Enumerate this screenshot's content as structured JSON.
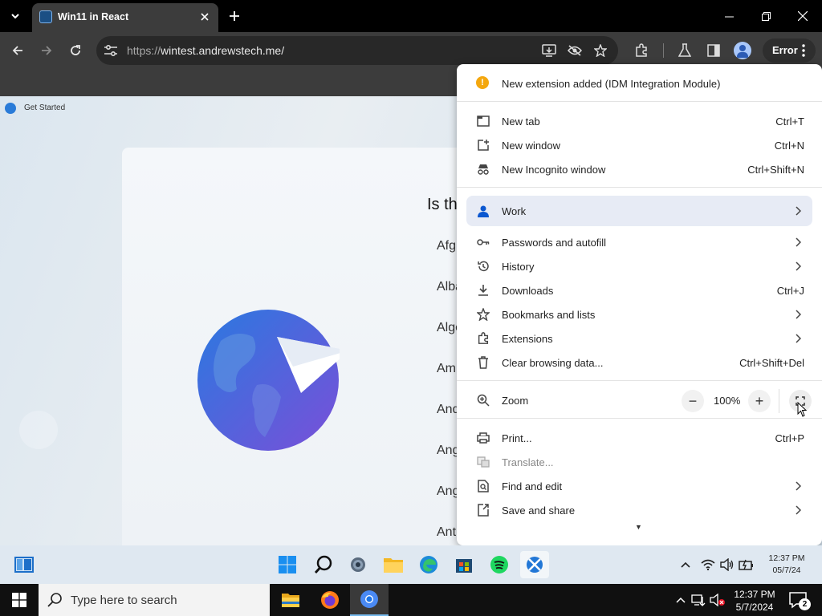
{
  "browser": {
    "tab": {
      "title": "Win11 in React"
    },
    "omnibox": {
      "protocol": "https://",
      "host": "wintest.andrewstech.me/"
    },
    "profile_status": "Error"
  },
  "page": {
    "get_started_label": "Get Started",
    "question": "Is th",
    "countries": [
      "Afg",
      "Alba",
      "Alge",
      "Am",
      "And",
      "Ang",
      "Ang",
      "Ant"
    ]
  },
  "menu": {
    "notice": "New extension added (IDM Integration Module)",
    "items": [
      {
        "label": "New tab",
        "shortcut": "Ctrl+T"
      },
      {
        "label": "New window",
        "shortcut": "Ctrl+N"
      },
      {
        "label": "New Incognito window",
        "shortcut": "Ctrl+Shift+N"
      },
      {
        "label": "Work"
      },
      {
        "label": "Passwords and autofill"
      },
      {
        "label": "History"
      },
      {
        "label": "Downloads",
        "shortcut": "Ctrl+J"
      },
      {
        "label": "Bookmarks and lists"
      },
      {
        "label": "Extensions"
      },
      {
        "label": "Clear browsing data...",
        "shortcut": "Ctrl+Shift+Del"
      },
      {
        "label": "Zoom"
      },
      {
        "label": "Print...",
        "shortcut": "Ctrl+P"
      },
      {
        "label": "Translate..."
      },
      {
        "label": "Find and edit"
      },
      {
        "label": "Save and share"
      }
    ],
    "zoom": {
      "value": "100%",
      "minus": "−",
      "plus": "+"
    }
  },
  "win11_taskbar": {
    "clock_time": "12:37 PM",
    "clock_date": "05/7/24"
  },
  "taskbar": {
    "search_placeholder": "Type here to search",
    "clock_time": "12:37 PM",
    "clock_date": "5/7/2024",
    "notification_count": "2"
  },
  "colors": {
    "accent": "#1a73e8",
    "work_highlight": "#e7ebf5",
    "warning": "#f4a70e"
  }
}
